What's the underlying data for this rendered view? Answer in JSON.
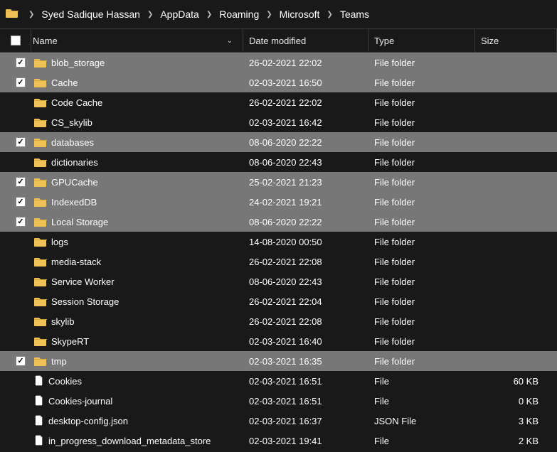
{
  "breadcrumb": [
    "Syed Sadique Hassan",
    "AppData",
    "Roaming",
    "Microsoft",
    "Teams"
  ],
  "columns": {
    "name": "Name",
    "date": "Date modified",
    "type": "Type",
    "size": "Size"
  },
  "items": [
    {
      "name": "blob_storage",
      "date": "26-02-2021 22:02",
      "type": "File folder",
      "size": "",
      "icon": "folder",
      "selected": true
    },
    {
      "name": "Cache",
      "date": "02-03-2021 16:50",
      "type": "File folder",
      "size": "",
      "icon": "folder",
      "selected": true
    },
    {
      "name": "Code Cache",
      "date": "26-02-2021 22:02",
      "type": "File folder",
      "size": "",
      "icon": "folder",
      "selected": false
    },
    {
      "name": "CS_skylib",
      "date": "02-03-2021 16:42",
      "type": "File folder",
      "size": "",
      "icon": "folder",
      "selected": false
    },
    {
      "name": "databases",
      "date": "08-06-2020 22:22",
      "type": "File folder",
      "size": "",
      "icon": "folder",
      "selected": true
    },
    {
      "name": "dictionaries",
      "date": "08-06-2020 22:43",
      "type": "File folder",
      "size": "",
      "icon": "folder",
      "selected": false
    },
    {
      "name": "GPUCache",
      "date": "25-02-2021 21:23",
      "type": "File folder",
      "size": "",
      "icon": "folder",
      "selected": true
    },
    {
      "name": "IndexedDB",
      "date": "24-02-2021 19:21",
      "type": "File folder",
      "size": "",
      "icon": "folder",
      "selected": true
    },
    {
      "name": "Local Storage",
      "date": "08-06-2020 22:22",
      "type": "File folder",
      "size": "",
      "icon": "folder",
      "selected": true
    },
    {
      "name": "logs",
      "date": "14-08-2020 00:50",
      "type": "File folder",
      "size": "",
      "icon": "folder",
      "selected": false
    },
    {
      "name": "media-stack",
      "date": "26-02-2021 22:08",
      "type": "File folder",
      "size": "",
      "icon": "folder",
      "selected": false
    },
    {
      "name": "Service Worker",
      "date": "08-06-2020 22:43",
      "type": "File folder",
      "size": "",
      "icon": "folder",
      "selected": false
    },
    {
      "name": "Session Storage",
      "date": "26-02-2021 22:04",
      "type": "File folder",
      "size": "",
      "icon": "folder",
      "selected": false
    },
    {
      "name": "skylib",
      "date": "26-02-2021 22:08",
      "type": "File folder",
      "size": "",
      "icon": "folder",
      "selected": false
    },
    {
      "name": "SkypeRT",
      "date": "02-03-2021 16:40",
      "type": "File folder",
      "size": "",
      "icon": "folder",
      "selected": false
    },
    {
      "name": "tmp",
      "date": "02-03-2021 16:35",
      "type": "File folder",
      "size": "",
      "icon": "folder",
      "selected": true
    },
    {
      "name": "Cookies",
      "date": "02-03-2021 16:51",
      "type": "File",
      "size": "60 KB",
      "icon": "file",
      "selected": false
    },
    {
      "name": "Cookies-journal",
      "date": "02-03-2021 16:51",
      "type": "File",
      "size": "0 KB",
      "icon": "file",
      "selected": false
    },
    {
      "name": "desktop-config.json",
      "date": "02-03-2021 16:37",
      "type": "JSON File",
      "size": "3 KB",
      "icon": "file",
      "selected": false
    },
    {
      "name": "in_progress_download_metadata_store",
      "date": "02-03-2021 19:41",
      "type": "File",
      "size": "2 KB",
      "icon": "file",
      "selected": false
    }
  ]
}
